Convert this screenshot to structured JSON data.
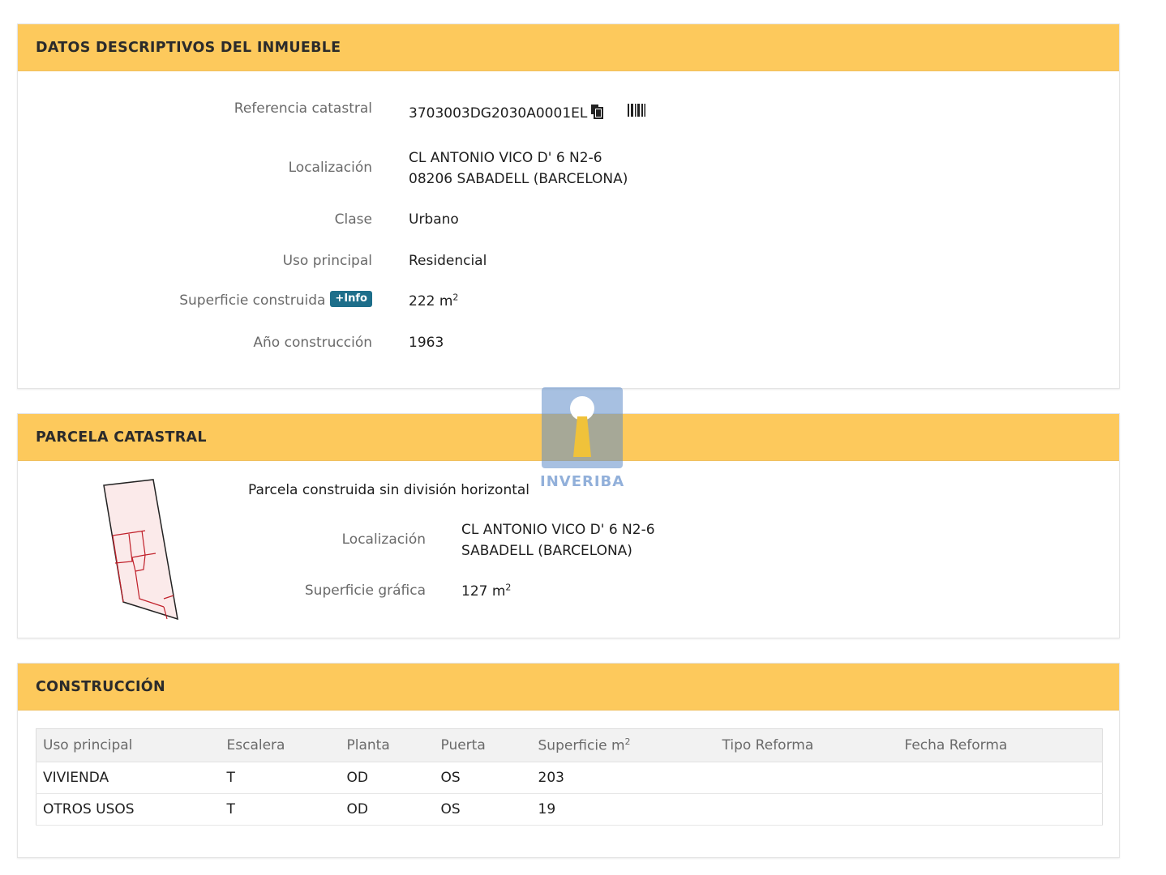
{
  "datos": {
    "header": "DATOS DESCRIPTIVOS DEL INMUEBLE",
    "referencia_label": "Referencia catastral",
    "referencia_value": "3703003DG2030A0001EL",
    "localizacion_label": "Localización",
    "localizacion_line1": "CL ANTONIO VICO D' 6 N2-6",
    "localizacion_line2": "08206 SABADELL (BARCELONA)",
    "clase_label": "Clase",
    "clase_value": "Urbano",
    "uso_label": "Uso principal",
    "uso_value": "Residencial",
    "superficie_label": "Superficie construida",
    "info_badge": "+Info",
    "superficie_value": "222 m",
    "superficie_unit_exp": "2",
    "anio_label": "Año construcción",
    "anio_value": "1963"
  },
  "parcela": {
    "header": "PARCELA CATASTRAL",
    "subtitle": "Parcela construida sin división horizontal",
    "localizacion_label": "Localización",
    "localizacion_line1": "CL ANTONIO VICO D' 6 N2-6",
    "localizacion_line2": "SABADELL (BARCELONA)",
    "superficie_label": "Superficie gráfica",
    "superficie_value": "127 m",
    "superficie_unit_exp": "2"
  },
  "watermark": {
    "text": "INVERIBA"
  },
  "construccion": {
    "header": "CONSTRUCCIÓN",
    "columns": [
      "Uso principal",
      "Escalera",
      "Planta",
      "Puerta",
      "Superficie m",
      "Tipo Reforma",
      "Fecha Reforma"
    ],
    "superficie_col_exp": "2",
    "rows": [
      [
        "VIVIENDA",
        "T",
        "OD",
        "OS",
        "203",
        "",
        ""
      ],
      [
        "OTROS USOS",
        "T",
        "OD",
        "OS",
        "19",
        "",
        ""
      ]
    ]
  },
  "colors": {
    "header_bg": "#fdc95c",
    "badge_bg": "#1d6e8a",
    "parcel_line": "#c0202a"
  },
  "icons": [
    "copy-icon",
    "barcode-icon",
    "parcel-plan-icon",
    "keyhole-logo-icon"
  ]
}
